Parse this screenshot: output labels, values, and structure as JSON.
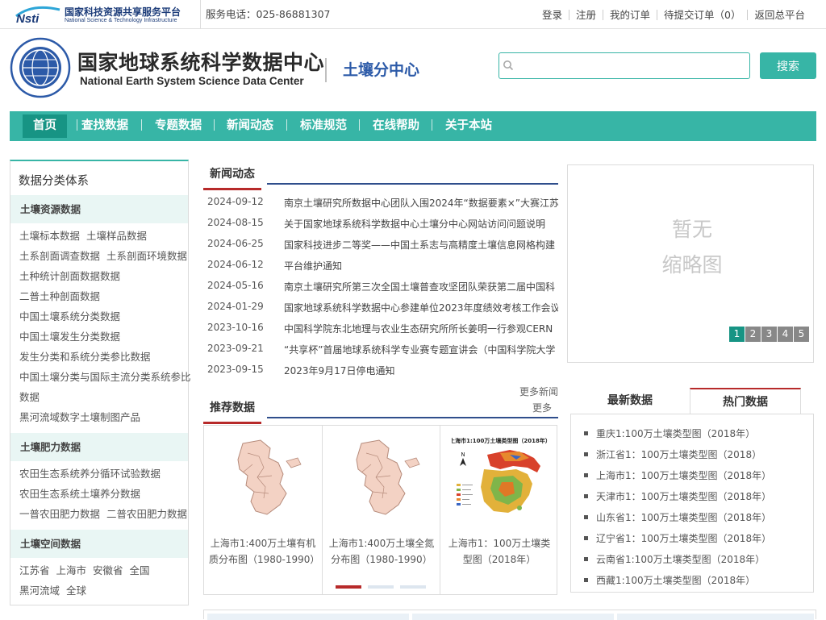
{
  "topbar": {
    "logo_cn": "国家科技资源共享服务平台",
    "logo_en": "National Science & Technology Infrastructure",
    "phone": "服务电话：025-86881307",
    "links": [
      "登录",
      "注册",
      "我的订单",
      "待提交订单（0）",
      "返回总平台"
    ]
  },
  "header": {
    "title_cn": "国家地球系统科学数据中心",
    "title_en": "National Earth System Science Data Center",
    "sub_center": "土壤分中心",
    "search_placeholder": "",
    "search_button": "搜索"
  },
  "nav": [
    "首页",
    "查找数据",
    "专题数据",
    "新闻动态",
    "标准规范",
    "在线帮助",
    "关于本站"
  ],
  "nav_active": "首页",
  "sidebar": {
    "title": "数据分类体系",
    "groups": [
      {
        "heading": "土壤资源数据",
        "rows": [
          [
            "土壤标本数据",
            "土壤样品数据"
          ],
          [
            "土系剖面调查数据",
            "土系剖面环境数据"
          ],
          [
            "土种统计剖面数据数据"
          ],
          [
            "二普土种剖面数据"
          ],
          [
            "中国土壤系统分类数据"
          ],
          [
            "中国土壤发生分类数据"
          ],
          [
            "发生分类和系统分类参比数据"
          ],
          [
            "中国土壤分类与国际主流分类系统参比"
          ],
          [
            "数据"
          ],
          [
            "黑河流域数字土壤制图产品"
          ]
        ]
      },
      {
        "heading": "土壤肥力数据",
        "rows": [
          [
            "农田生态系统养分循环试验数据"
          ],
          [
            "农田生态系统土壤养分数据"
          ],
          [
            "一普农田肥力数据",
            "二普农田肥力数据"
          ]
        ]
      },
      {
        "heading": "土壤空间数据",
        "rows": [
          [
            "江苏省",
            "上海市",
            "安徽省",
            "全国"
          ],
          [
            "黑河流域",
            "全球"
          ]
        ]
      }
    ]
  },
  "news": {
    "heading": "新闻动态",
    "more": "更多新闻",
    "items": [
      {
        "date": "2024-09-12",
        "title": "南京土壤研究所数据中心团队入围2024年“数据要素×”大赛江苏"
      },
      {
        "date": "2024-08-15",
        "title": "关于国家地球系统科学数据中心土壤分中心网站访问问题说明"
      },
      {
        "date": "2024-06-25",
        "title": "国家科技进步二等奖——中国土系志与高精度土壤信息网格构建"
      },
      {
        "date": "2024-06-12",
        "title": "平台维护通知"
      },
      {
        "date": "2024-05-16",
        "title": "南京土壤研究所第三次全国土壤普查攻坚团队荣获第二届中国科"
      },
      {
        "date": "2024-01-29",
        "title": "国家地球系统科学数据中心参建单位2023年度绩效考核工作会议"
      },
      {
        "date": "2023-10-16",
        "title": "中国科学院东北地理与农业生态研究所所长姜明一行参观CERN"
      },
      {
        "date": "2023-09-21",
        "title": "“共享杯”首届地球系统科学专业赛专题宣讲会（中国科学院大学"
      },
      {
        "date": "2023-09-15",
        "title": "2023年9月17日停电通知"
      }
    ]
  },
  "slider": {
    "placeholder_line1": "暂无",
    "placeholder_line2": "缩略图",
    "pages": [
      "1",
      "2",
      "3",
      "4",
      "5"
    ],
    "active_page": "1"
  },
  "recommend": {
    "heading": "推荐数据",
    "more": "更多",
    "cards": [
      {
        "label": "上海市1:400万土壤有机质分布图（1980-1990）"
      },
      {
        "label": "上海市1:400万土壤全氮分布图（1980-1990）"
      },
      {
        "label": "上海市1：100万土壤类型图（2018年）",
        "thumb_title": "上海市1:100万土壤类型图（2018年）",
        "north": "N"
      }
    ]
  },
  "data_tabs": {
    "tabs": [
      "最新数据",
      "热门数据"
    ],
    "active": "热门数据",
    "items": [
      "重庆1:100万土壤类型图（2018年）",
      "浙江省1：100万土壤类型图（2018）",
      "上海市1：100万土壤类型图（2018年）",
      "天津市1：100万土壤类型图（2018年）",
      "山东省1：100万土壤类型图（2018年）",
      "辽宁省1：100万土壤类型图（2018年）",
      "云南省1:100万土壤类型图（2018年）",
      "西藏1:100万土壤类型图（2018年）"
    ]
  },
  "colors": {
    "teal": "#37b5a6",
    "teal_dark": "#179484",
    "red_accent": "#b72a2a",
    "navy": "#2f4e8c"
  }
}
